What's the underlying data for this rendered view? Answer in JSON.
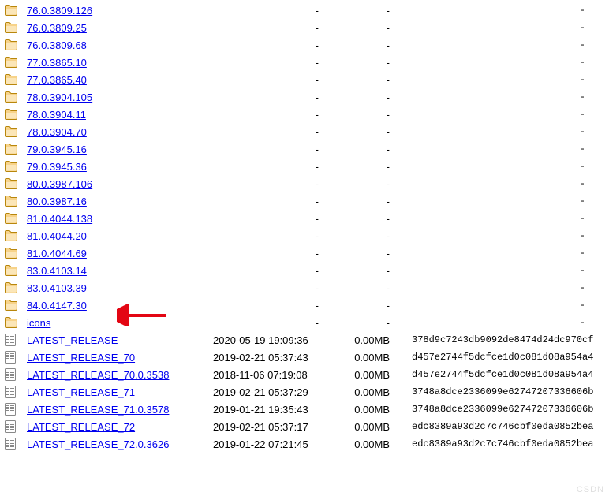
{
  "folders": [
    {
      "name": "76.0.3809.126"
    },
    {
      "name": "76.0.3809.25"
    },
    {
      "name": "76.0.3809.68"
    },
    {
      "name": "77.0.3865.10"
    },
    {
      "name": "77.0.3865.40"
    },
    {
      "name": "78.0.3904.105"
    },
    {
      "name": "78.0.3904.11"
    },
    {
      "name": "78.0.3904.70"
    },
    {
      "name": "79.0.3945.16"
    },
    {
      "name": "79.0.3945.36"
    },
    {
      "name": "80.0.3987.106"
    },
    {
      "name": "80.0.3987.16"
    },
    {
      "name": "81.0.4044.138"
    },
    {
      "name": "81.0.4044.20"
    },
    {
      "name": "81.0.4044.69"
    },
    {
      "name": "83.0.4103.14",
      "highlight": true
    },
    {
      "name": "83.0.4103.39"
    },
    {
      "name": "84.0.4147.30"
    },
    {
      "name": "icons"
    }
  ],
  "files": [
    {
      "name": "LATEST_RELEASE",
      "date": "2020-05-19 19:09:36",
      "size": "0.00MB",
      "hash": "378d9c7243db9092de8474d24dc970cf"
    },
    {
      "name": "LATEST_RELEASE_70",
      "date": "2019-02-21 05:37:43",
      "size": "0.00MB",
      "hash": "d457e2744f5dcfce1d0c081d08a954a4"
    },
    {
      "name": "LATEST_RELEASE_70.0.3538",
      "date": "2018-11-06 07:19:08",
      "size": "0.00MB",
      "hash": "d457e2744f5dcfce1d0c081d08a954a4"
    },
    {
      "name": "LATEST_RELEASE_71",
      "date": "2019-02-21 05:37:29",
      "size": "0.00MB",
      "hash": "3748a8dce2336099e62747207336606b"
    },
    {
      "name": "LATEST_RELEASE_71.0.3578",
      "date": "2019-01-21 19:35:43",
      "size": "0.00MB",
      "hash": "3748a8dce2336099e62747207336606b"
    },
    {
      "name": "LATEST_RELEASE_72",
      "date": "2019-02-21 05:37:17",
      "size": "0.00MB",
      "hash": "edc8389a93d2c7c746cbf0eda0852bea"
    },
    {
      "name": "LATEST_RELEASE_72.0.3626",
      "date": "2019-01-22 07:21:45",
      "size": "0.00MB",
      "hash": "edc8389a93d2c7c746cbf0eda0852bea"
    }
  ],
  "dash": "-",
  "watermark": "CSDN"
}
